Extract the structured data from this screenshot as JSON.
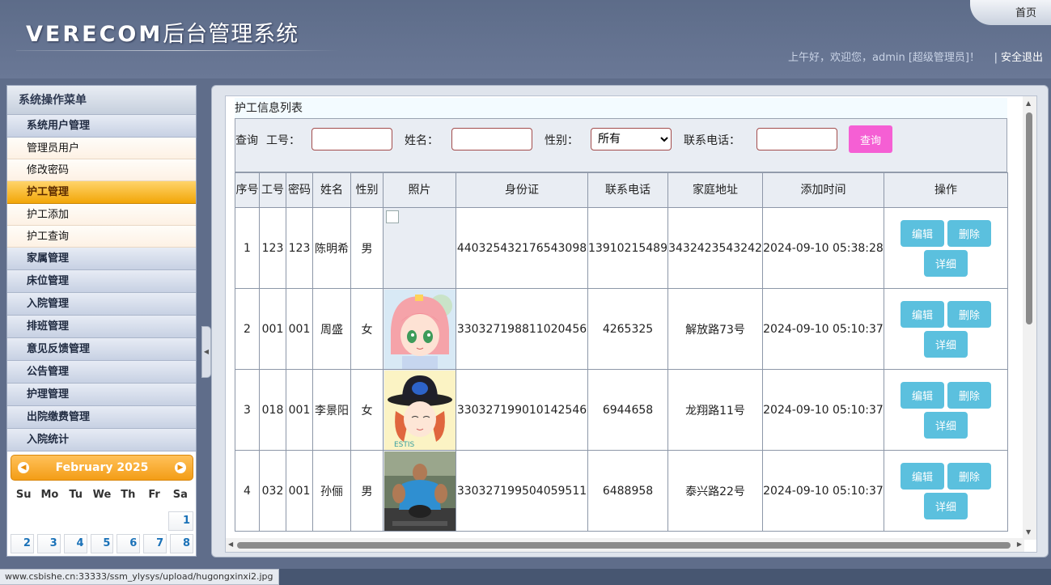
{
  "header": {
    "logo_en": "VERECOM",
    "logo_cn": "后台管理系统",
    "home": "首页",
    "welcome": "上午好，欢迎您，admin [超级管理员]！",
    "logout": "安全退出"
  },
  "sidebar": {
    "title": "系统操作菜单",
    "items": [
      {
        "label": "系统用户管理",
        "type": "group"
      },
      {
        "label": "管理员用户",
        "type": "sub"
      },
      {
        "label": "修改密码",
        "type": "sub"
      },
      {
        "label": "护工管理",
        "type": "group",
        "active": true
      },
      {
        "label": "护工添加",
        "type": "sub"
      },
      {
        "label": "护工查询",
        "type": "sub"
      },
      {
        "label": "家属管理",
        "type": "group"
      },
      {
        "label": "床位管理",
        "type": "group"
      },
      {
        "label": "入院管理",
        "type": "group"
      },
      {
        "label": "排班管理",
        "type": "group"
      },
      {
        "label": "意见反馈管理",
        "type": "group"
      },
      {
        "label": "公告管理",
        "type": "group"
      },
      {
        "label": "护理管理",
        "type": "group"
      },
      {
        "label": "出院缴费管理",
        "type": "group"
      },
      {
        "label": "入院统计",
        "type": "group"
      }
    ]
  },
  "calendar": {
    "month": "February 2025",
    "weekdays": [
      "Su",
      "Mo",
      "Tu",
      "We",
      "Th",
      "Fr",
      "Sa"
    ],
    "row1": [
      "",
      "",
      "",
      "",
      "",
      "",
      "1"
    ],
    "row2": [
      "2",
      "3",
      "4",
      "5",
      "6",
      "7",
      "8"
    ]
  },
  "main": {
    "title": "护工信息列表",
    "search": {
      "prefix": "查询",
      "gonghao_label": "工号：",
      "name_label": "姓名：",
      "gender_label": "性别：",
      "gender_selected": "所有",
      "phone_label": "联系电话：",
      "button": "查询"
    },
    "columns": [
      "序号",
      "工号",
      "密码",
      "姓名",
      "性别",
      "照片",
      "身份证",
      "联系电话",
      "家庭地址",
      "添加时间",
      "操作"
    ],
    "rows": [
      {
        "no": "1",
        "gonghao": "123",
        "mima": "123",
        "name": "陈明希",
        "gender": "男",
        "photo": "broken",
        "idcard": "440325432176543098",
        "phone": "13910215489",
        "address": "3432423543242",
        "time": "2024-09-10 05:38:28"
      },
      {
        "no": "2",
        "gonghao": "001",
        "mima": "001",
        "name": "周盛",
        "gender": "女",
        "photo": "anime-girl",
        "idcard": "330327198811020456",
        "phone": "4265325",
        "address": "解放路73号",
        "time": "2024-09-10 05:10:37"
      },
      {
        "no": "3",
        "gonghao": "018",
        "mima": "001",
        "name": "李景阳",
        "gender": "女",
        "photo": "hat-girl",
        "idcard": "330327199010142546",
        "phone": "6944658",
        "address": "龙翔路11号",
        "time": "2024-09-10 05:10:37"
      },
      {
        "no": "4",
        "gonghao": "032",
        "mima": "001",
        "name": "孙俪",
        "gender": "男",
        "photo": "gym-man",
        "idcard": "330327199504059511",
        "phone": "6488958",
        "address": "泰兴路22号",
        "time": "2024-09-10 05:10:37"
      }
    ],
    "ops": {
      "edit": "编辑",
      "delete": "删除",
      "detail": "详细"
    }
  },
  "status_bar": "www.csbishe.cn:33333/ssm_ylysys/upload/hugongxinxi2.jpg"
}
